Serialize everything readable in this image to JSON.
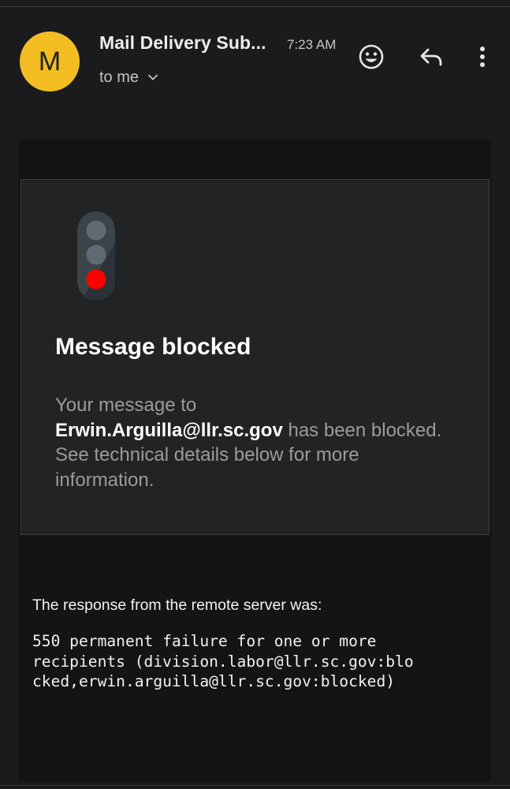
{
  "header": {
    "avatar_letter": "M",
    "sender": "Mail Delivery Sub...",
    "time": "7:23 AM",
    "recipient": "to me"
  },
  "icons": {
    "emoji": "add-reaction-icon",
    "reply": "reply-icon",
    "more": "more-vertical-icon",
    "chevron": "chevron-down-icon",
    "traffic_light": "traffic-light-icon"
  },
  "card": {
    "title": "Message blocked",
    "text_before": "Your message to",
    "email": "Erwin.Arguilla@llr.sc.gov",
    "text_after": "has been blocked. See technical details below for more information."
  },
  "response": {
    "label": "The response from the remote server was:",
    "code": "550 permanent failure for one or more\nrecipients (division.labor@llr.sc.gov:blo\ncked,erwin.arguilla@llr.sc.gov:blocked)"
  },
  "colors": {
    "avatar": "#f3bd23",
    "background": "#1a1b1d",
    "card": "#222325",
    "red_light": "#ff0000",
    "gray_light": "#5f6b73"
  }
}
